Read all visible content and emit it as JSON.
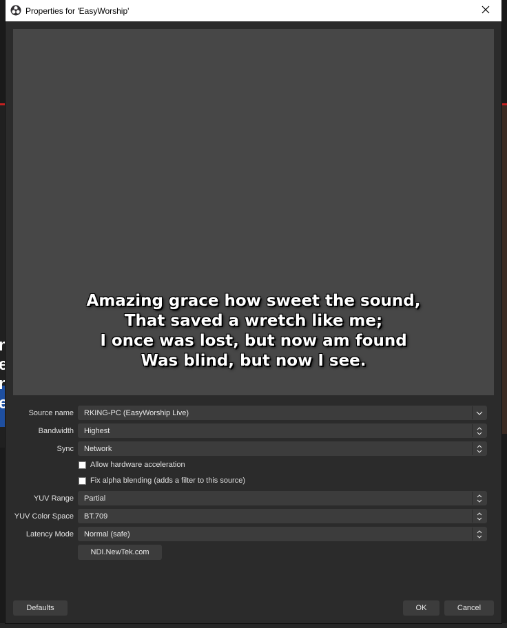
{
  "window": {
    "title": "Properties for 'EasyWorship'"
  },
  "preview": {
    "lines": [
      "Amazing grace how sweet the sound,",
      "That saved a wretch like me;",
      "I once was lost, but now am found",
      "Was blind, but now I see."
    ]
  },
  "form": {
    "source_name": {
      "label": "Source name",
      "value": "RKING-PC (EasyWorship Live)"
    },
    "bandwidth": {
      "label": "Bandwidth",
      "value": "Highest"
    },
    "sync": {
      "label": "Sync",
      "value": "Network"
    },
    "hw_accel": {
      "label": "Allow hardware acceleration",
      "checked": false
    },
    "alpha_fix": {
      "label": "Fix alpha blending (adds a filter to this source)",
      "checked": false
    },
    "yuv_range": {
      "label": "YUV Range",
      "value": "Partial"
    },
    "yuv_color_space": {
      "label": "YUV Color Space",
      "value": "BT.709"
    },
    "latency_mode": {
      "label": "Latency Mode",
      "value": "Normal (safe)"
    },
    "link_button": "NDI.NewTek.com"
  },
  "footer": {
    "defaults": "Defaults",
    "ok": "OK",
    "cancel": "Cancel"
  },
  "background": {
    "letters": [
      "n",
      "e",
      "n",
      "e"
    ]
  },
  "colors": {
    "dialog_bg": "#2b2b2b",
    "preview_bg": "#474747",
    "field_bg": "#3c3c3c"
  }
}
